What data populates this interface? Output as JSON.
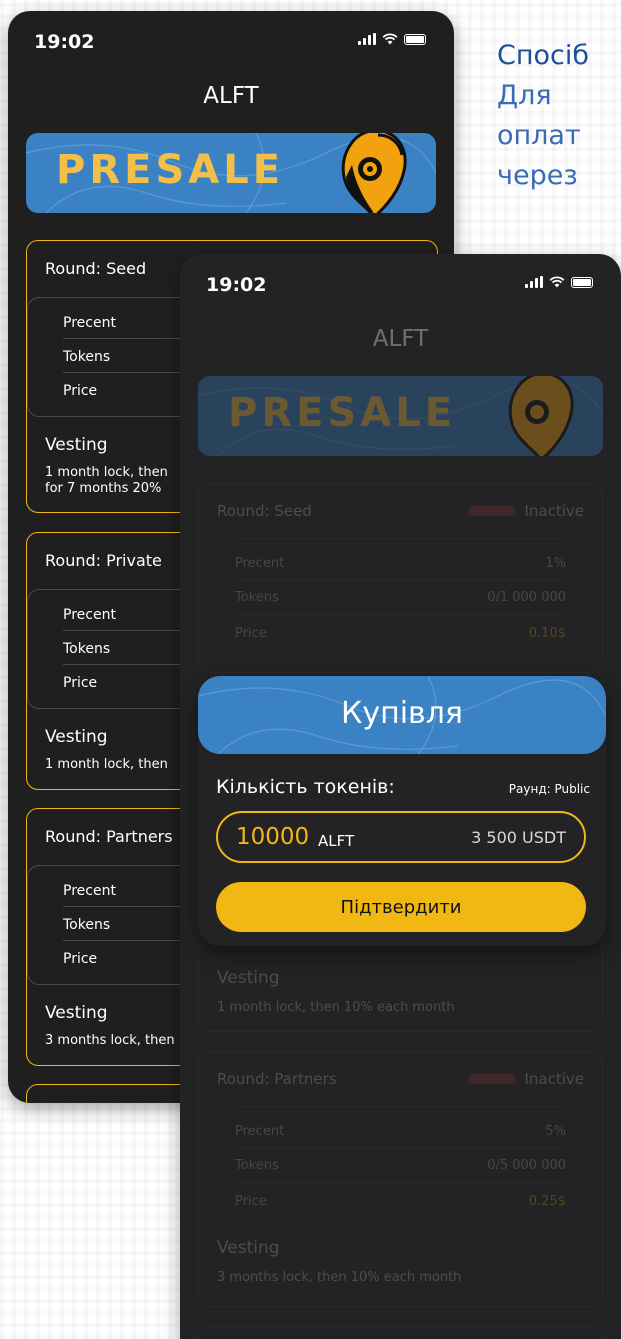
{
  "side_text": {
    "line1": "Спосіб",
    "line2": "Для",
    "line3": "оплат",
    "line4": "через"
  },
  "status_time": "19:02",
  "app_title": "ALFT",
  "banner_word": "PRESALE",
  "back_cards": [
    {
      "round": "Round: Seed",
      "rows": [
        "Precent",
        "Tokens",
        "Price"
      ],
      "vesting_label": "Vesting",
      "vesting_text_1": "1 month lock, then",
      "vesting_text_2": "for 7 months 20%"
    },
    {
      "round": "Round: Private",
      "rows": [
        "Precent",
        "Tokens",
        "Price"
      ],
      "vesting_label": "Vesting",
      "vesting_text_1": "1 month lock, then",
      "vesting_text_2": ""
    },
    {
      "round": "Round: Partners",
      "rows": [
        "Precent",
        "Tokens",
        "Price"
      ],
      "vesting_label": "Vesting",
      "vesting_text_1": "3 months lock, then",
      "vesting_text_2": ""
    }
  ],
  "front_cards": [
    {
      "round": "Round: Seed",
      "status": "Inactive",
      "precent_label": "Precent",
      "precent_value": "1%",
      "tokens_label": "Tokens",
      "tokens_value": "0/1 000 000",
      "price_label": "Price",
      "price_value": "0.10$"
    },
    {
      "vesting_label": "Vesting",
      "vesting_text": "1 month lock, then 10% each month"
    },
    {
      "round": "Round: Partners",
      "status": "Inactive",
      "precent_label": "Precent",
      "precent_value": "5%",
      "tokens_label": "Tokens",
      "tokens_value": "0/5 000 000",
      "price_label": "Price",
      "price_value": "0.25$",
      "vesting_label": "Vesting",
      "vesting_text": "3 months lock, then 10% each month"
    }
  ],
  "modal": {
    "title": "Купівля",
    "qty_label": "Кількість токенів:",
    "round_label": "Раунд: Public",
    "amount": "10000",
    "unit": "ALFT",
    "usdt": "3 500 USDT",
    "confirm_label": "Підтвердити"
  },
  "colors": {
    "accent_gold": "#f1b813",
    "banner_blue": "#3b82c4",
    "inactive_red": "#7a3535"
  }
}
